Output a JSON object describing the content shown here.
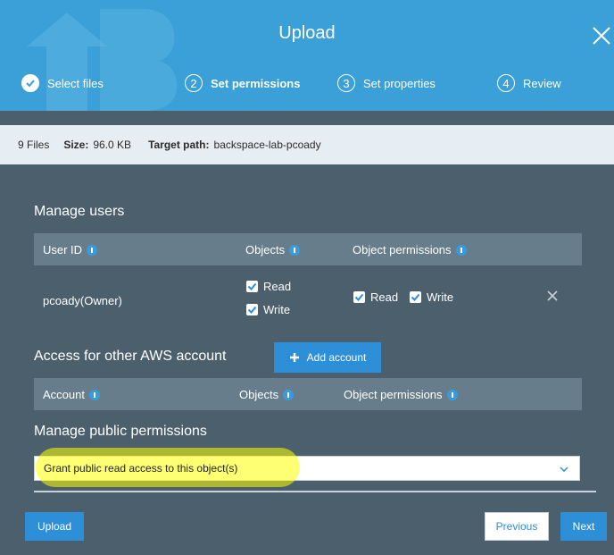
{
  "header": {
    "title": "Upload",
    "steps": [
      {
        "label": "Select files",
        "status": "done"
      },
      {
        "number": "2",
        "label": "Set permissions",
        "status": "active"
      },
      {
        "number": "3",
        "label": "Set properties",
        "status": "pending"
      },
      {
        "number": "4",
        "label": "Review",
        "status": "pending"
      }
    ]
  },
  "info": {
    "files": "9 Files",
    "size_label": "Size:",
    "size_value": "96.0 KB",
    "target_label": "Target path:",
    "target_value": "backspace-lab-pcoady"
  },
  "manage_users": {
    "title": "Manage users",
    "columns": [
      "User ID",
      "Objects",
      "Object permissions"
    ],
    "row": {
      "user": "pcoady(Owner)",
      "objects": [
        {
          "label": "Read",
          "checked": true
        },
        {
          "label": "Write",
          "checked": true
        }
      ],
      "object_permissions": [
        {
          "label": "Read",
          "checked": true
        },
        {
          "label": "Write",
          "checked": true
        }
      ]
    }
  },
  "other_account": {
    "title": "Access for other AWS account",
    "add_button": "Add account",
    "columns": [
      "Account",
      "Objects",
      "Object permissions"
    ]
  },
  "public": {
    "title": "Manage public permissions",
    "selected": "Grant public read access to this object(s)"
  },
  "footer": {
    "upload": "Upload",
    "previous": "Previous",
    "next": "Next"
  },
  "colors": {
    "header": "#3aa0d7",
    "body": "#4b5f6c",
    "table_head": "#677d8b",
    "primary": "#2c8fd8",
    "highlight": "#ffff00"
  }
}
